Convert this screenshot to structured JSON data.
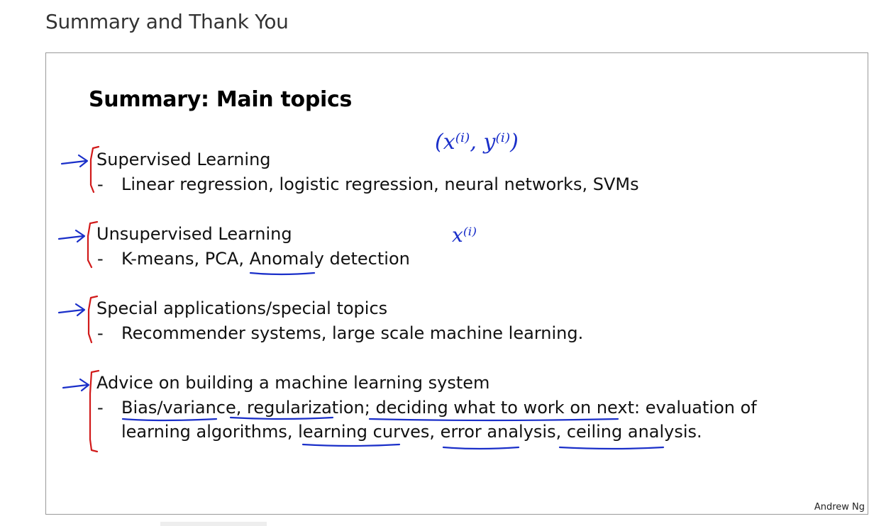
{
  "page": {
    "heading": "Summary and Thank You"
  },
  "slide": {
    "title": "Summary: Main topics",
    "topics": [
      {
        "heading": "Supervised Learning",
        "detail": "Linear regression, logistic regression, neural networks, SVMs",
        "detail_cont": ""
      },
      {
        "heading": "Unsupervised Learning",
        "detail": "K-means, PCA, Anomaly detection",
        "detail_cont": ""
      },
      {
        "heading": "Special applications/special topics",
        "detail": "Recommender systems, large scale machine learning.",
        "detail_cont": ""
      },
      {
        "heading": "Advice on building a machine learning system",
        "detail": "Bias/variance, regularization; deciding what to work on next: evaluation of",
        "detail_cont": "learning algorithms, learning curves, error analysis, ceiling analysis."
      }
    ],
    "dash": "-",
    "annotations": {
      "supervised_note": "(x⁽ⁱ⁾, y⁽ⁱ⁾)",
      "unsupervised_note": "x⁽ⁱ⁾"
    },
    "author": "Andrew Ng"
  },
  "colors": {
    "ink_blue": "#1a2fc9",
    "ink_red": "#d11a1a"
  }
}
